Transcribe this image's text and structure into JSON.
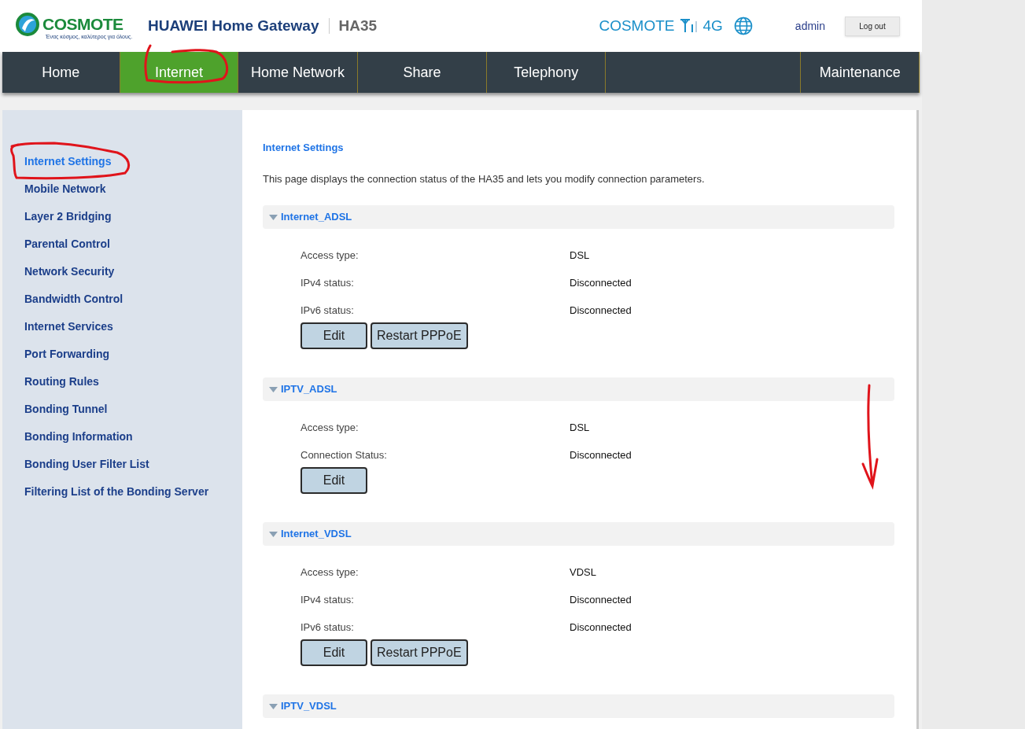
{
  "header": {
    "brand": "COSMOTE",
    "tagline": "Ένας κόσμος, καλύτερος για όλους.",
    "product": "HUAWEI Home Gateway",
    "model": "HA35",
    "operator": "COSMOTE",
    "network_type": "4G",
    "user": "admin",
    "logout": "Log out"
  },
  "nav": [
    {
      "kind": "tab",
      "label": "Home",
      "selected": false,
      "circled": false
    },
    {
      "kind": "tab",
      "label": "Internet",
      "selected": true,
      "circled": true
    },
    {
      "kind": "tab",
      "label": "Home Network",
      "selected": false,
      "circled": false
    },
    {
      "kind": "tab",
      "label": "Share",
      "selected": false,
      "circled": false
    },
    {
      "kind": "tab",
      "label": "Telephony",
      "selected": false,
      "circled": false
    },
    {
      "kind": "spacer"
    },
    {
      "kind": "tab",
      "label": "Maintenance",
      "selected": false,
      "circled": false
    }
  ],
  "sidebar": {
    "items": [
      {
        "label": "Internet Settings",
        "selected": true,
        "circled": true
      },
      {
        "label": "Mobile Network",
        "selected": false,
        "circled": false
      },
      {
        "label": "Layer 2 Bridging",
        "selected": false,
        "circled": false
      },
      {
        "label": "Parental Control",
        "selected": false,
        "circled": false
      },
      {
        "label": "Network Security",
        "selected": false,
        "circled": false
      },
      {
        "label": "Bandwidth Control",
        "selected": false,
        "circled": false
      },
      {
        "label": "Internet Services",
        "selected": false,
        "circled": false
      },
      {
        "label": "Port Forwarding",
        "selected": false,
        "circled": false
      },
      {
        "label": "Routing Rules",
        "selected": false,
        "circled": false
      },
      {
        "label": "Bonding Tunnel",
        "selected": false,
        "circled": false
      },
      {
        "label": "Bonding Information",
        "selected": false,
        "circled": false
      },
      {
        "label": "Bonding User Filter List",
        "selected": false,
        "circled": false
      },
      {
        "label": "Filtering List of the Bonding Server",
        "selected": false,
        "circled": false
      }
    ]
  },
  "content": {
    "title": "Internet Settings",
    "description": "This page displays the connection status of the HA35 and lets you modify connection parameters.",
    "sections": [
      {
        "name": "Internet_ADSL",
        "expanded": true,
        "rows": [
          {
            "label": "Access type:",
            "value": "DSL"
          },
          {
            "label": "IPv4 status:",
            "value": "Disconnected"
          },
          {
            "label": "IPv6 status:",
            "value": "Disconnected"
          }
        ],
        "buttons": [
          "Edit",
          "Restart PPPoE"
        ]
      },
      {
        "name": "IPTV_ADSL",
        "expanded": true,
        "rows": [
          {
            "label": "Access type:",
            "value": "DSL"
          },
          {
            "label": "Connection Status:",
            "value": "Disconnected"
          }
        ],
        "buttons": [
          "Edit"
        ],
        "arrow_annotation": true
      },
      {
        "name": "Internet_VDSL",
        "expanded": true,
        "rows": [
          {
            "label": "Access type:",
            "value": "VDSL"
          },
          {
            "label": "IPv4 status:",
            "value": "Disconnected"
          },
          {
            "label": "IPv6 status:",
            "value": "Disconnected"
          }
        ],
        "buttons": [
          "Edit",
          "Restart PPPoE"
        ]
      },
      {
        "name": "IPTV_VDSL",
        "expanded": true
      }
    ]
  }
}
